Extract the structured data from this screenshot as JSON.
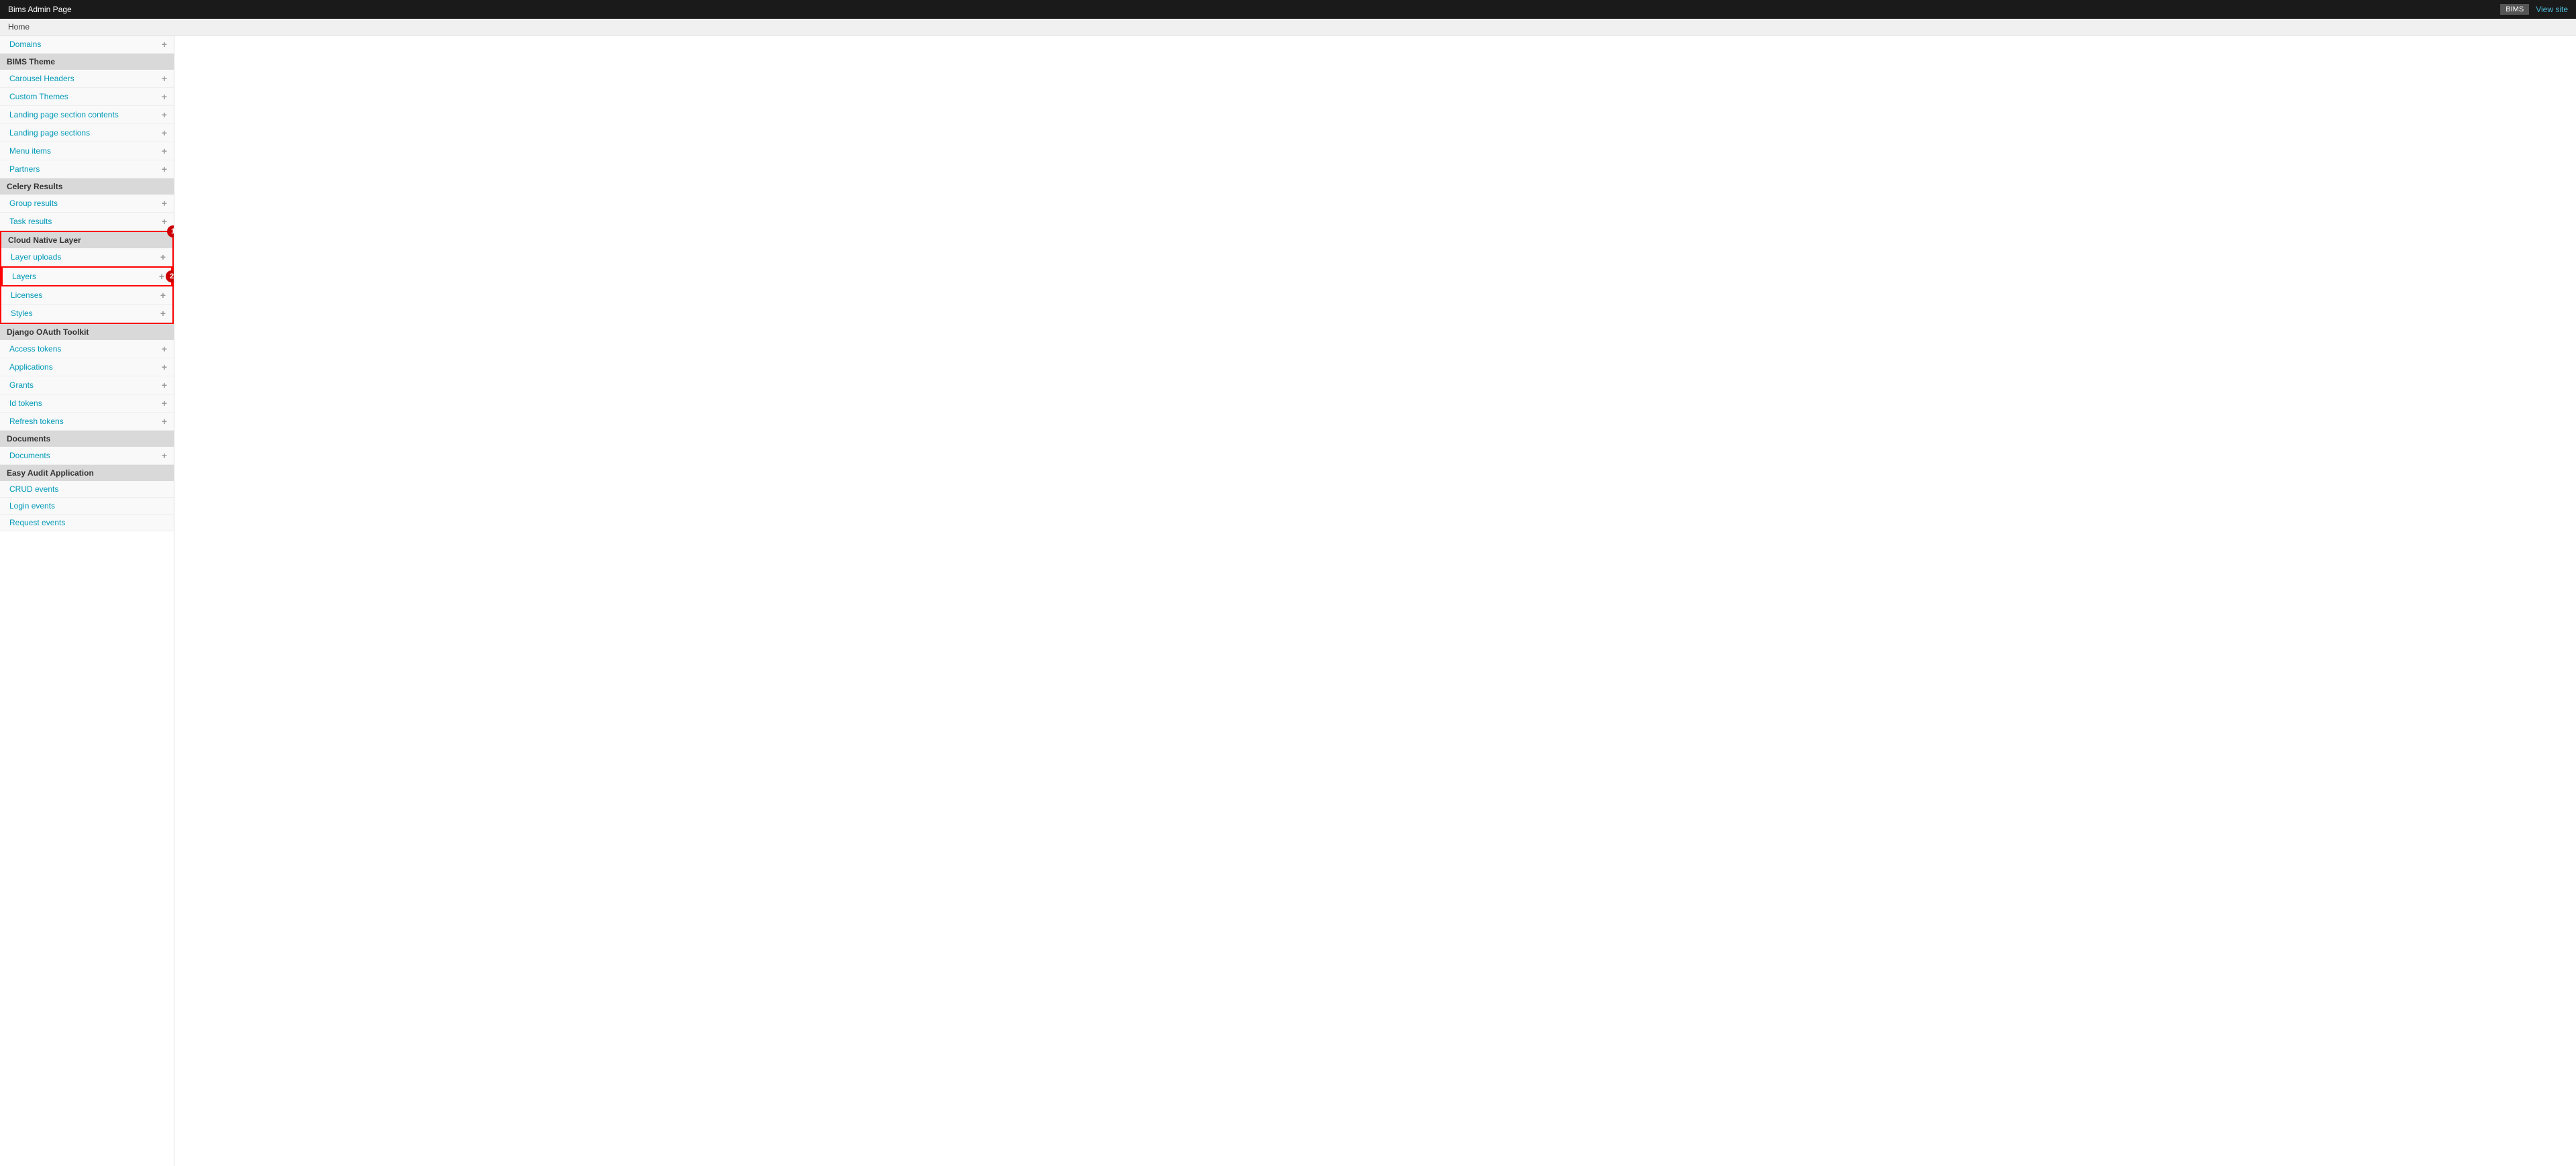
{
  "topbar": {
    "title": "Bims Admin Page",
    "button_label": "BIMS",
    "view_site_label": "View site"
  },
  "breadcrumb": {
    "label": "Home"
  },
  "sidebar": {
    "sections": [
      {
        "id": "bims-theme",
        "header": "BIMS Theme",
        "is_header_only": true,
        "items": [
          {
            "label": "Domains",
            "has_plus": true
          },
          {
            "label": "Carousel Headers",
            "has_plus": true
          },
          {
            "label": "Custom Themes",
            "has_plus": true
          },
          {
            "label": "Landing page section contents",
            "has_plus": true
          },
          {
            "label": "Landing page sections",
            "has_plus": true
          },
          {
            "label": "Menu items",
            "has_plus": true
          },
          {
            "label": "Partners",
            "has_plus": true
          }
        ]
      },
      {
        "id": "celery-results",
        "header": "Celery Results",
        "items": [
          {
            "label": "Group results",
            "has_plus": true
          },
          {
            "label": "Task results",
            "has_plus": true
          }
        ]
      },
      {
        "id": "cloud-native-layer",
        "header": "Cloud Native Layer",
        "highlighted": true,
        "items": [
          {
            "label": "Layer uploads",
            "has_plus": true
          },
          {
            "label": "Layers",
            "has_plus": true,
            "highlighted": true
          },
          {
            "label": "Licenses",
            "has_plus": true
          },
          {
            "label": "Styles",
            "has_plus": true
          }
        ]
      },
      {
        "id": "django-oauth",
        "header": "Django OAuth Toolkit",
        "items": [
          {
            "label": "Access tokens",
            "has_plus": true
          },
          {
            "label": "Applications",
            "has_plus": true
          },
          {
            "label": "Grants",
            "has_plus": true
          },
          {
            "label": "Id tokens",
            "has_plus": true
          },
          {
            "label": "Refresh tokens",
            "has_plus": true
          }
        ]
      },
      {
        "id": "documents",
        "header": "Documents",
        "items": [
          {
            "label": "Documents",
            "has_plus": true
          }
        ]
      },
      {
        "id": "easy-audit",
        "header": "Easy Audit Application",
        "items": [
          {
            "label": "CRUD events",
            "has_plus": false
          },
          {
            "label": "Login events",
            "has_plus": false
          },
          {
            "label": "Request events",
            "has_plus": false
          }
        ]
      }
    ]
  }
}
